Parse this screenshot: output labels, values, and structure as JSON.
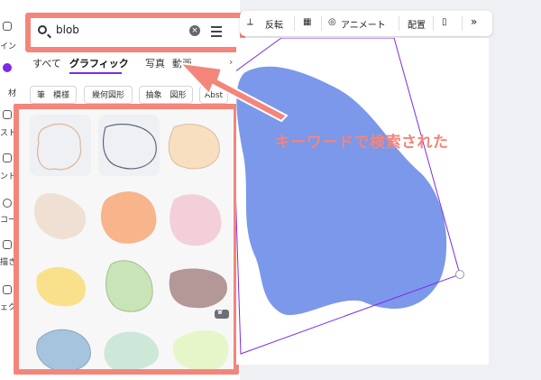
{
  "rail": {
    "items": [
      "イン",
      "材",
      "スト",
      "ンド",
      "コー",
      "描き",
      "ェク"
    ]
  },
  "search": {
    "value": "blob",
    "clear_icon": "×"
  },
  "tabs": [
    {
      "label": "すべて",
      "active": false
    },
    {
      "label": "グラフィック",
      "active": true
    },
    {
      "label": "写真",
      "active": false
    },
    {
      "label": "動画",
      "active": false
    }
  ],
  "chips": [
    "筆　模様",
    "幾何図形",
    "抽象　図形",
    "Abst"
  ],
  "results": {
    "items": [
      {
        "name": "outline-blob-peach",
        "fill": "none",
        "stroke": "#e0b49b"
      },
      {
        "name": "outline-blob-dark",
        "fill": "none",
        "stroke": "#5a6a7a"
      },
      {
        "name": "blob-peach-outline",
        "fill": "#f7dfbf",
        "stroke": "#d9bfa0"
      },
      {
        "name": "blob-beige",
        "fill": "#efe0d3",
        "stroke": "none"
      },
      {
        "name": "blob-orange",
        "fill": "#f8b48b",
        "stroke": "none"
      },
      {
        "name": "blob-pink",
        "fill": "#f2cfd9",
        "stroke": "none"
      },
      {
        "name": "blob-yellow",
        "fill": "#f9e08a",
        "stroke": "none"
      },
      {
        "name": "blob-green",
        "fill": "#c9e4b6",
        "stroke": "#9fc08a"
      },
      {
        "name": "blob-mauve",
        "fill": "#b49797",
        "stroke": "none"
      },
      {
        "name": "blob-blue",
        "fill": "#a7c4de",
        "stroke": "#8aa6c0"
      },
      {
        "name": "blob-mint",
        "fill": "#cde8d8",
        "stroke": "none"
      },
      {
        "name": "blob-lime",
        "fill": "#e6f6c8",
        "stroke": "none"
      }
    ],
    "premium_badge": "♛"
  },
  "toolbar": {
    "flip_label": "反転",
    "animate_label": "アニメート",
    "arrange_label": "配置",
    "more_label": "»"
  },
  "canvas": {
    "blob_color": "#7b98ea",
    "frame_color": "#7d2ae8"
  },
  "annotation": {
    "text": "キーワードで検索された",
    "color": "#f4857a"
  }
}
